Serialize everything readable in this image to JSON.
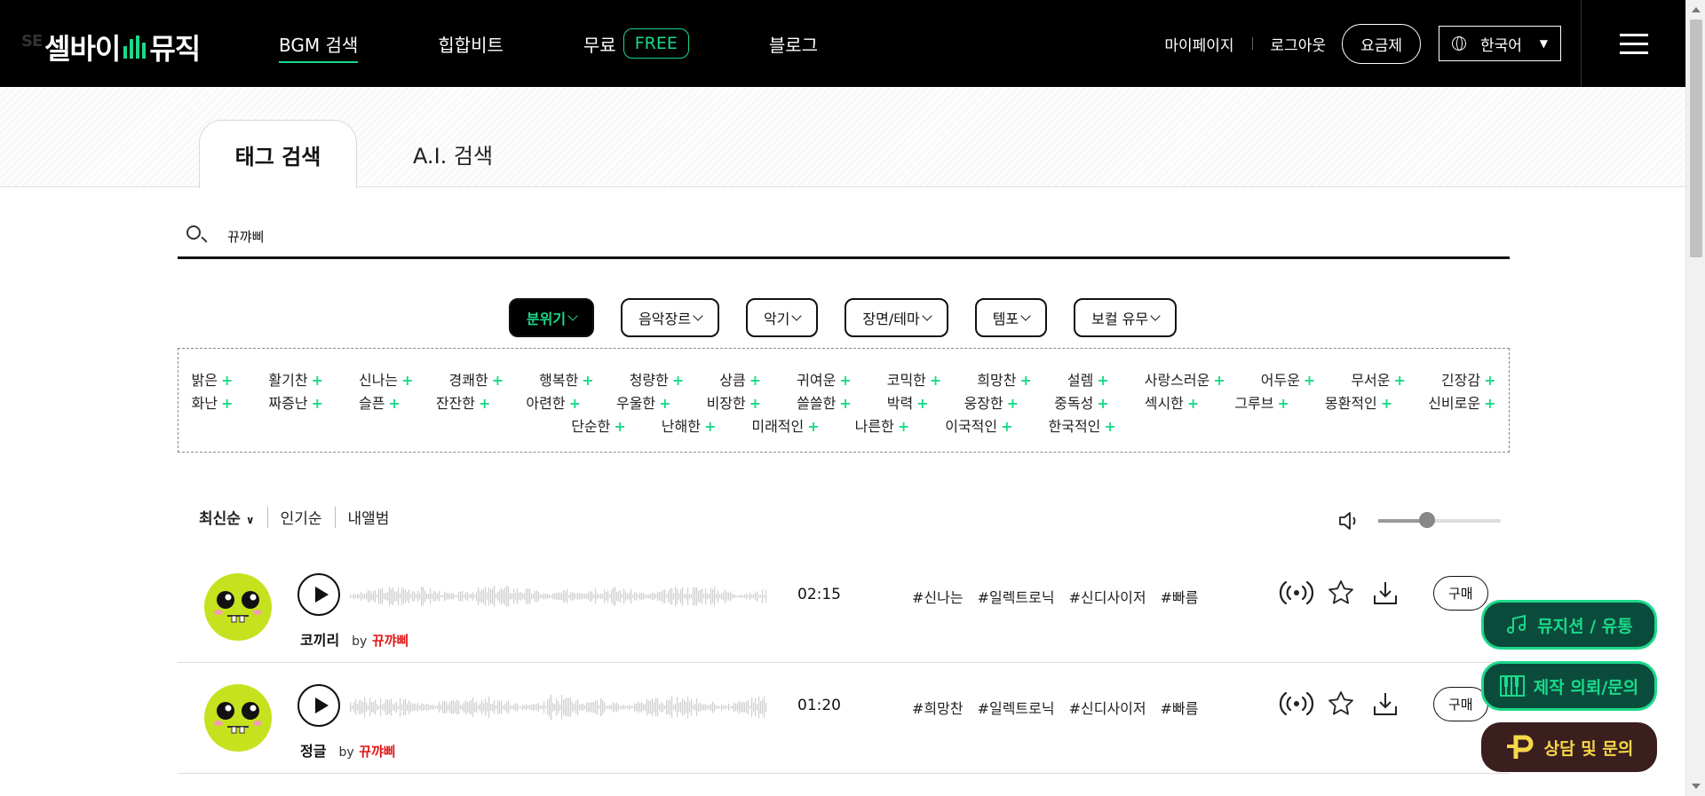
{
  "header": {
    "logo": "셀바이뮤직",
    "logo_part1": "셀바이",
    "logo_part2": "뮤직",
    "logo_ghost": "SE",
    "nav": [
      {
        "label": "BGM 검색",
        "active": true
      },
      {
        "label": "힙합비트"
      },
      {
        "label": "무료",
        "badge": "FREE"
      },
      {
        "label": "블로그"
      }
    ],
    "mypage": "마이페이지",
    "logout": "로그아웃",
    "pricing": "요금제",
    "language": "한국어",
    "accent_color": "#1bd98a"
  },
  "tabs": [
    {
      "label": "태그 검색",
      "active": true
    },
    {
      "label": "A.I. 검색"
    }
  ],
  "search": {
    "value": "뀨꺄삐",
    "icon": "search-icon"
  },
  "filters": [
    {
      "label": "분위기",
      "active": true
    },
    {
      "label": "음악장르"
    },
    {
      "label": "악기"
    },
    {
      "label": "장면/테마"
    },
    {
      "label": "템포"
    },
    {
      "label": "보컬 유무"
    }
  ],
  "tag_rows": [
    [
      "밝은",
      "활기찬",
      "신나는",
      "경쾌한",
      "행복한",
      "청량한",
      "상큼",
      "귀여운",
      "코믹한",
      "희망찬",
      "설렘",
      "사랑스러운",
      "어두운",
      "무서운",
      "긴장감"
    ],
    [
      "화난",
      "짜증난",
      "슬픈",
      "잔잔한",
      "아련한",
      "우울한",
      "비장한",
      "쓸쓸한",
      "박력",
      "웅장한",
      "중독성",
      "섹시한",
      "그루브",
      "몽환적인",
      "신비로운"
    ],
    [
      "단순한",
      "난해한",
      "미래적인",
      "나른한",
      "이국적인",
      "한국적인"
    ]
  ],
  "tag_plus": "+",
  "sort": {
    "options": [
      "최신순",
      "인기순",
      "내앨범"
    ]
  },
  "volume": {
    "level": 0.4
  },
  "tracks": [
    {
      "title": "코끼리",
      "by": "by",
      "artist": "뀨꺄삐",
      "duration": "02:15",
      "tags": [
        "#신나는",
        "#일렉트로닉",
        "#신디사이저",
        "#빠름"
      ],
      "buy": "구매"
    },
    {
      "title": "정글",
      "by": "by",
      "artist": "뀨꺄삐",
      "duration": "01:20",
      "tags": [
        "#희망찬",
        "#일렉트로닉",
        "#신디사이저",
        "#빠름"
      ],
      "buy": "구매"
    }
  ],
  "floating": [
    {
      "label": "뮤지션 / 유통",
      "icon": "music-note-icon"
    },
    {
      "label": "제작 의뢰/문의",
      "icon": "piano-icon"
    },
    {
      "label": "상담 및 문의",
      "icon": "kakao-p-icon"
    }
  ]
}
